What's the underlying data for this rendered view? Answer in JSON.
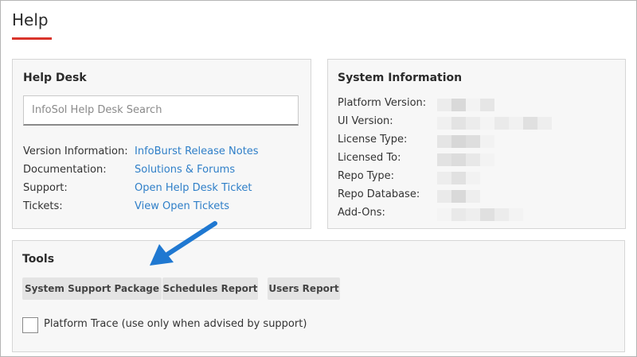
{
  "page": {
    "title": "Help"
  },
  "helpdesk": {
    "title": "Help Desk",
    "search_placeholder": "InfoSol Help Desk Search",
    "rows": [
      {
        "label": "Version Information:",
        "link": "InfoBurst Release Notes"
      },
      {
        "label": "Documentation:",
        "link": "Solutions & Forums"
      },
      {
        "label": "Support:",
        "link": "Open Help Desk Ticket"
      },
      {
        "label": "Tickets:",
        "link": "View Open Tickets"
      }
    ]
  },
  "sysinfo": {
    "title": "System Information",
    "rows": [
      {
        "label": "Platform Version:"
      },
      {
        "label": "UI Version:"
      },
      {
        "label": "License Type:"
      },
      {
        "label": "Licensed To:"
      },
      {
        "label": "Repo Type:"
      },
      {
        "label": "Repo Database:"
      },
      {
        "label": "Add-Ons:"
      }
    ]
  },
  "tools": {
    "title": "Tools",
    "buttons": [
      {
        "label": "System Support Package"
      },
      {
        "label": "Schedules Report"
      },
      {
        "label": "Users Report"
      }
    ],
    "trace_label": "Platform Trace (use only when advised by support)",
    "trace_checked": false
  },
  "colors": {
    "accent_underline": "#d9342b",
    "link": "#2f7fc8",
    "annotation_arrow": "#1f78d1"
  },
  "icons": {
    "annotation": "arrow-pointer-icon"
  }
}
